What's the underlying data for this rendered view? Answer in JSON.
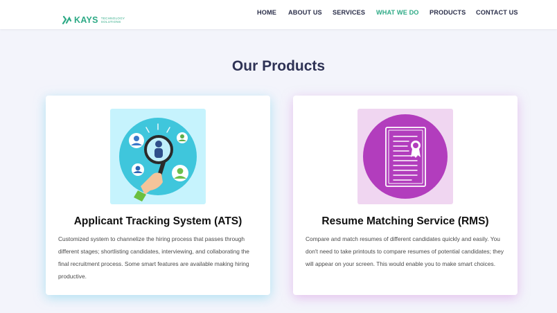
{
  "header": {
    "logo": {
      "brand": "KAYS",
      "tagline_line1": "TECHNOLOGY",
      "tagline_line2": "SOLUTIONS"
    },
    "nav": [
      {
        "label": "HOME",
        "active": false
      },
      {
        "label": "ABOUT US",
        "active": false
      },
      {
        "label": "SERVICES",
        "active": false
      },
      {
        "label": "WHAT WE DO",
        "active": true
      },
      {
        "label": "PRODUCTS",
        "active": false
      },
      {
        "label": "CONTACT US",
        "active": false
      }
    ]
  },
  "main": {
    "title": "Our Products",
    "products": [
      {
        "title": "Applicant Tracking System (ATS)",
        "description": "Customized system to channelize the hiring process that passes through different stages; shortlisting candidates, interviewing, and collaborating the final recruitment process. Some smart features are available making hiring productive.",
        "icon": "magnifier-candidates-icon"
      },
      {
        "title": "Resume Matching Service (RMS)",
        "description": "Compare and match resumes of different candidates quickly and easily. You don't need to take printouts to compare resumes of potential candidates; they will appear on your screen. This would enable you to make smart choices.",
        "icon": "certificate-document-icon"
      }
    ]
  },
  "colors": {
    "accent": "#2eaa86",
    "heading": "#2e3255",
    "ats_bg": "#c6f3fd",
    "ats_circle": "#3fc6dc",
    "rms_bg": "#f0d6f1",
    "rms_circle": "#b23dbd"
  }
}
